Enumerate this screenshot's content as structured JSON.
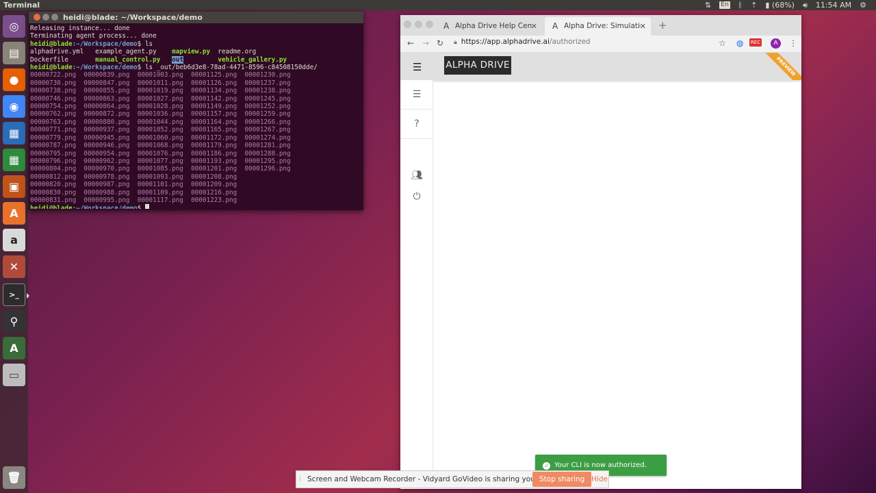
{
  "panel": {
    "app_title": "Terminal",
    "keyboard": "En",
    "battery": "(68%)",
    "clock": "11:54 AM"
  },
  "launcher": {
    "items": [
      "ubuntu-dash",
      "files",
      "firefox",
      "chrome",
      "writer",
      "calc",
      "impress",
      "software-center",
      "amazon",
      "system-settings",
      "terminal",
      "ejecter",
      "updater",
      "drive",
      "trash"
    ]
  },
  "terminal": {
    "window_title": "heidi@blade: ~/Workspace/demo",
    "line1": "Releasing instance... done",
    "line2": "Terminating agent process... done",
    "prompt_user": "heidi@blade",
    "prompt_path": ":~/Workspace/demo",
    "prompt_symbol": "$",
    "cmd1": " ls",
    "ls_row1": [
      "alphadrive.yml",
      "example_agent.py",
      "mapview.py",
      "readme.org"
    ],
    "ls_row2": [
      "Dockerfile",
      "manual_control.py",
      "out",
      "vehicle_gallery.py"
    ],
    "cmd2": " ls _out/beb6d3e8-78ad-4471-8596-c84508150dde/",
    "png_rows": [
      "00000722.png  00000839.png  00001003.png  00001125.png  00001230.png",
      "00000730.png  00000847.png  00001011.png  00001126.png  00001237.png",
      "00000738.png  00000855.png  00001019.png  00001134.png  00001238.png",
      "00000746.png  00000863.png  00001027.png  00001142.png  00001245.png",
      "00000754.png  00000864.png  00001028.png  00001149.png  00001252.png",
      "00000762.png  00000872.png  00001036.png  00001157.png  00001259.png",
      "00000763.png  00000880.png  00001044.png  00001164.png  00001266.png",
      "00000771.png  00000937.png  00001052.png  00001165.png  00001267.png",
      "00000779.png  00000945.png  00001060.png  00001172.png  00001274.png",
      "00000787.png  00000946.png  00001068.png  00001179.png  00001281.png",
      "00000795.png  00000954.png  00001076.png  00001186.png  00001288.png",
      "00000796.png  00000962.png  00001077.png  00001193.png  00001295.png",
      "00000804.png  00000970.png  00001085.png  00001201.png  00001296.png",
      "00000812.png  00000978.png  00001093.png  00001208.png",
      "00000820.png  00000987.png  00001101.png  00001209.png",
      "00000830.png  00000988.png  00001109.png  00001216.png",
      "00000831.png  00000995.png  00001117.png  00001223.png"
    ]
  },
  "browser": {
    "tabs": [
      {
        "title": "Alpha Drive Help Center",
        "icon": "A"
      },
      {
        "title": "Alpha Drive: Simulation a",
        "icon": "A"
      }
    ],
    "url_host": "https://app.alphadrive.ai",
    "url_path": "/authorized",
    "profile_initial": "A",
    "rec_label": "REC",
    "app_logo": "ALPHA DRIVE",
    "ribbon": "PREVIEW"
  },
  "toast": {
    "message": "Your CLI is now authorized."
  },
  "share_bar": {
    "message": "Screen and Webcam Recorder - Vidyard GoVideo is sharing your screen.",
    "stop_label": "Stop sharing",
    "hide_label": "Hide"
  }
}
